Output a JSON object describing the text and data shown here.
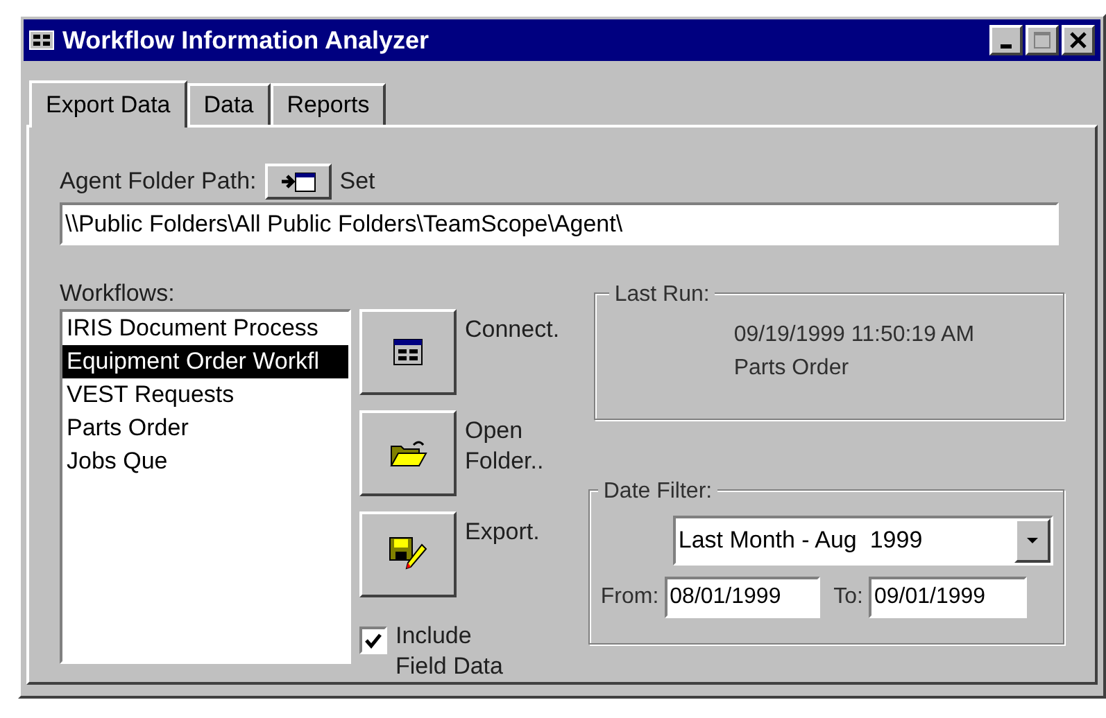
{
  "window": {
    "title": "Workflow Information Analyzer"
  },
  "tabs": [
    {
      "label": "Export Data",
      "selected": true
    },
    {
      "label": "Data",
      "selected": false
    },
    {
      "label": "Reports",
      "selected": false
    }
  ],
  "agent_folder": {
    "label": "Agent Folder Path:",
    "set_label": "Set",
    "path": "\\\\Public Folders\\All Public Folders\\TeamScope\\Agent\\"
  },
  "workflows": {
    "label": "Workflows:",
    "items": [
      {
        "label": "IRIS Document Process",
        "selected": false
      },
      {
        "label": "Equipment Order Workfl",
        "selected": true
      },
      {
        "label": "VEST Requests",
        "selected": false
      },
      {
        "label": "Parts Order",
        "selected": false
      },
      {
        "label": "Jobs Que",
        "selected": false
      }
    ]
  },
  "actions": [
    {
      "kind": "connect",
      "label": "Connect."
    },
    {
      "kind": "open",
      "label": "Open Folder.."
    },
    {
      "kind": "export",
      "label": "Export."
    }
  ],
  "include_field_data": {
    "label": "Include Field Data",
    "checked": true
  },
  "last_run": {
    "title": "Last Run:",
    "timestamp": "09/19/1999 11:50:19 AM",
    "workflow": "Parts Order"
  },
  "date_filter": {
    "title": "Date Filter:",
    "range": "Last Month - Aug  1999",
    "from_label": "From:",
    "from": "08/01/1999",
    "to_label": "To:",
    "to": "09/01/1999"
  }
}
